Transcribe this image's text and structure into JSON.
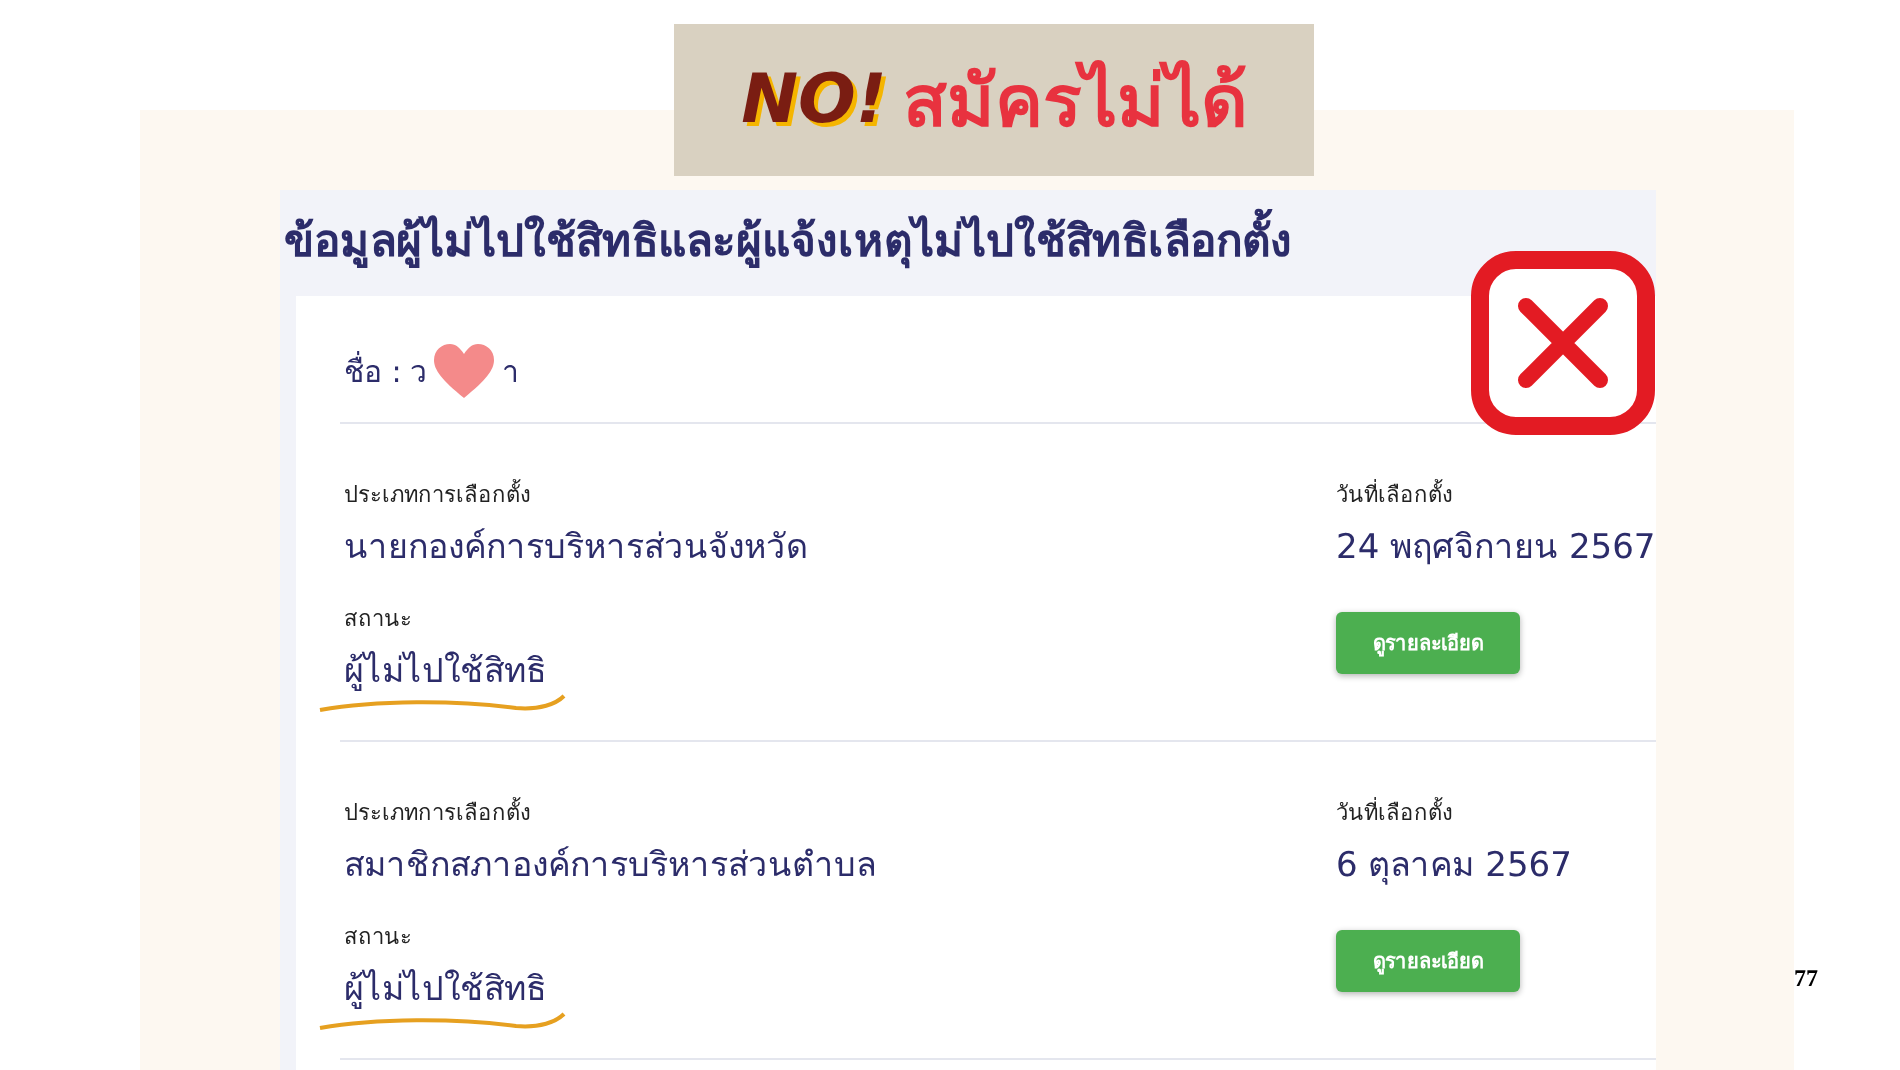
{
  "banner": {
    "exclaim": "NO!",
    "text": "สมัครไม่ได้"
  },
  "title": "ข้อมูลผู้ไม่ไปใช้สิทธิและผู้แจ้งเหตุไม่ไปใช้สิทธิเลือกตั้ง",
  "name": {
    "label": "ชื่อ :",
    "start": "ว",
    "end": "า"
  },
  "elections": [
    {
      "type_label": "ประเภทการเลือกตั้ง",
      "type": "นายกองค์การบริหารส่วนจังหวัด",
      "date_label": "วันที่เลือกตั้ง",
      "date": "24 พฤศจิกายน 2567",
      "status_label": "สถานะ",
      "status": "ผู้ไม่ไปใช้สิทธิ",
      "button": "ดูรายละเอียด"
    },
    {
      "type_label": "ประเภทการเลือกตั้ง",
      "type": "สมาชิกสภาองค์การบริหารส่วนตำบล",
      "date_label": "วันที่เลือกตั้ง",
      "date": "6 ตุลาคม 2567",
      "status_label": "สถานะ",
      "status": "ผู้ไม่ไปใช้สิทธิ",
      "button": "ดูรายละเอียด"
    }
  ],
  "page_number": "77"
}
